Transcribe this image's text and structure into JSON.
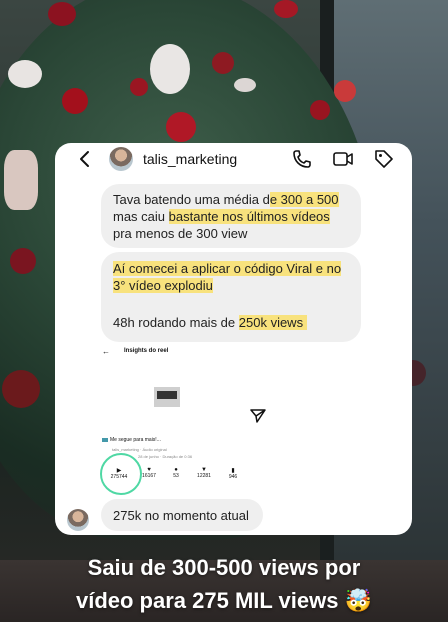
{
  "chat": {
    "username": "talis_marketing",
    "messages": [
      {
        "lines": [
          [
            {
              "t": "Tava batendo uma média d"
            },
            {
              "t": "e 300 a 500",
              "hl": true
            }
          ],
          [
            {
              "t": "mas caiu "
            },
            {
              "t": "bastante nos últimos vídeos",
              "hl": true
            }
          ],
          [
            {
              "t": "pra menos de 300 view"
            }
          ]
        ]
      },
      {
        "lines": [
          [
            {
              "t": "Aí comecei a aplicar o código Viral e no",
              "hl": true
            }
          ],
          [
            {
              "t": "3° vídeo explodiu",
              "hl": true
            }
          ],
          [
            {
              "t": ""
            }
          ],
          [
            {
              "t": "48h rodando mais de "
            },
            {
              "t": "250k views ",
              "hl": true
            }
          ]
        ]
      },
      {
        "lines": [
          [
            {
              "t": "275k no momento atual"
            }
          ]
        ]
      }
    ]
  },
  "insights": {
    "title": "Insights do reel",
    "caption": "Me segue para mais!...",
    "subline": "talis_marketing · Áudio original",
    "date": "28 de junho · Duração de 0:36",
    "stats": [
      {
        "icon": "play-icon",
        "glyph": "▶",
        "value": "275744"
      },
      {
        "icon": "heart-icon",
        "glyph": "♥",
        "value": "16167"
      },
      {
        "icon": "comment-icon",
        "glyph": "●",
        "value": "53"
      },
      {
        "icon": "share-icon",
        "glyph": "▼",
        "value": "12281"
      },
      {
        "icon": "bookmark-icon",
        "glyph": "▮",
        "value": "946"
      }
    ]
  },
  "overlay": {
    "line1": "Saiu de 300-500 views por",
    "line2": "vídeo para 275 MIL views 🤯"
  },
  "colors": {
    "highlight": "#f8e27d",
    "ring": "#4fd8a4"
  }
}
